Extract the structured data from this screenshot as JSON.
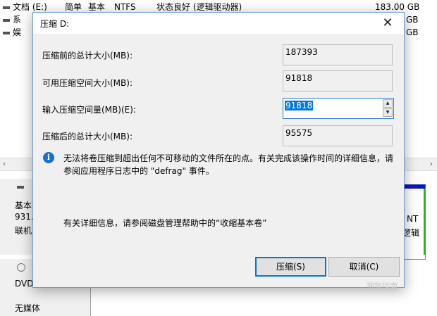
{
  "background": {
    "volume_rows": [
      {
        "name": "文档 (E:)",
        "layout": "简单",
        "type": "基本",
        "fs": "NTFS",
        "status": "状态良好 (逻辑驱动器)",
        "capacity": "183.00 GB"
      },
      {
        "name": "系",
        "capacity": "GB"
      },
      {
        "name": "娱",
        "capacity": "GB"
      }
    ],
    "disk0": {
      "line1": "基本",
      "line2": "931.",
      "line3": "联机"
    },
    "dvd": {
      "line1": "DVD",
      "line2": "无媒体"
    },
    "partition_right": {
      "line1": "NT",
      "line2": "逻辑"
    }
  },
  "dialog": {
    "title": "压缩 D:",
    "fields": [
      {
        "label": "压缩前的总计大小(MB):",
        "value": "187393"
      },
      {
        "label": "可用压缩空间大小(MB):",
        "value": "91818"
      },
      {
        "label": "输入压缩空间量(MB)(E):",
        "value": "91818"
      },
      {
        "label": "压缩后的总计大小(MB):",
        "value": "95575"
      }
    ],
    "info_message": "无法将卷压缩到超出任何不可移动的文件所在的点。有关完成该操作时间的详细信息，请参阅应用程序日志中的 \"defrag\" 事件。",
    "help_message": "有关详细信息，请参阅磁盘管理帮助中的“收缩基本卷”",
    "shrink_button": "压缩(S)",
    "cancel_button": "取消(C)"
  },
  "watermark": "搜狗指南"
}
